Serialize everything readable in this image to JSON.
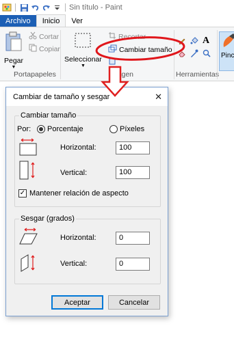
{
  "window": {
    "title": "Sin título - Paint"
  },
  "quick_access": {
    "icons": [
      "paint-app-icon",
      "save-icon",
      "undo-icon",
      "redo-icon",
      "customize-qat-icon"
    ]
  },
  "tabs": [
    {
      "label": "Archivo"
    },
    {
      "label": "Inicio"
    },
    {
      "label": "Ver"
    }
  ],
  "ribbon": {
    "clipboard": {
      "paste_label": "Pegar",
      "cut_label": "Cortar",
      "copy_label": "Copiar",
      "group_label": "Portapapeles"
    },
    "image": {
      "select_label": "Seleccionar",
      "crop_label": "Recortar",
      "resize_label": "Cambiar tamaño",
      "group_label": "Imagen"
    },
    "tools": {
      "group_label": "Herramientas"
    },
    "brushes": {
      "label": "Pinc"
    }
  },
  "dialog": {
    "title": "Cambiar de tamaño y sesgar",
    "resize": {
      "legend": "Cambiar tamaño",
      "by_label": "Por:",
      "option_percent": "Porcentaje",
      "option_pixels": "Píxeles",
      "selected": "Porcentaje",
      "horizontal_label": "Horizontal:",
      "horizontal_value": "100",
      "vertical_label": "Vertical:",
      "vertical_value": "100",
      "keep_aspect_label": "Mantener relación de aspecto",
      "keep_aspect_checked": true
    },
    "skew": {
      "legend": "Sesgar (grados)",
      "horizontal_label": "Horizontal:",
      "horizontal_value": "0",
      "vertical_label": "Vertical:",
      "vertical_value": "0"
    },
    "ok_label": "Aceptar",
    "cancel_label": "Cancelar"
  },
  "colors": {
    "file_tab": "#1c5fb5",
    "annotation": "#e0161b",
    "dialog_border": "#7a9fd0",
    "arrow_red": "#e02020"
  }
}
